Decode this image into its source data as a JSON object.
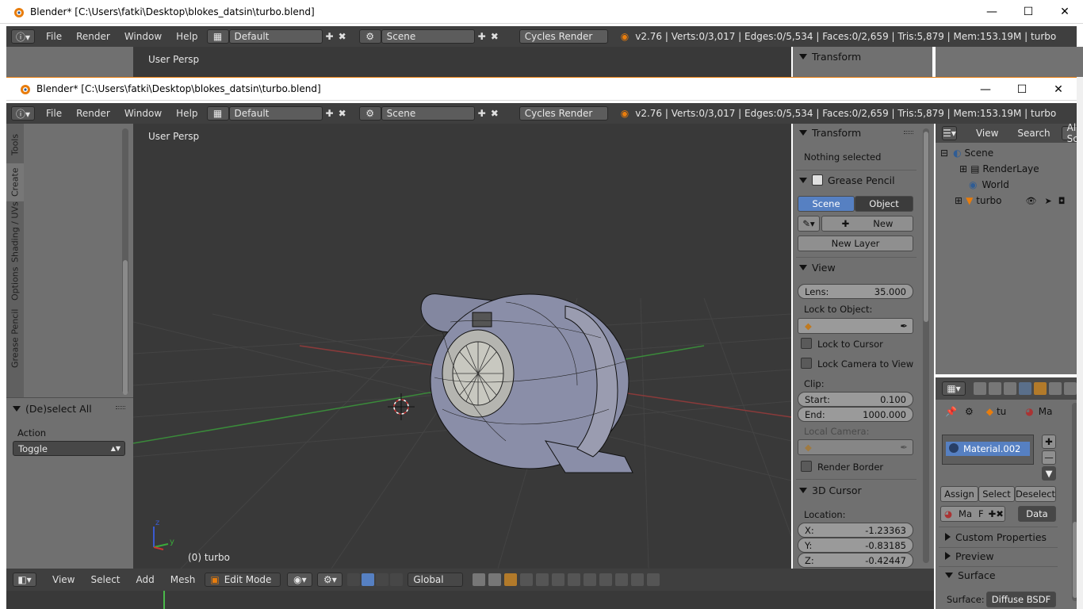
{
  "window": {
    "title": "Blender* [C:\\Users\\fatki\\Desktop\\blokes_datsin\\turbo.blend]",
    "minimize": "—",
    "maximize": "☐",
    "close": "✕"
  },
  "menu": [
    "File",
    "Render",
    "Window",
    "Help"
  ],
  "layout": {
    "name": "Default"
  },
  "scene": {
    "name": "Scene"
  },
  "render_engine": "Cycles Render",
  "stats": "v2.76 | Verts:0/3,017 | Edges:0/5,534 | Faces:0/2,659 | Tris:5,879 | Mem:153.19M | turbo",
  "toolshelf": {
    "tabs": [
      "Tools",
      "Create",
      "Shading / UVs",
      "Options",
      "Grease Pencil"
    ],
    "operator": {
      "title": "(De)select All",
      "action_label": "Action",
      "action_value": "Toggle"
    }
  },
  "viewport": {
    "view_name": "User Persp",
    "object_label": "(0) turbo",
    "axis_z": "z",
    "axis_y": "y"
  },
  "properties_panel": {
    "transform": {
      "title": "Transform",
      "status": "Nothing selected"
    },
    "grease_pencil": {
      "title": "Grease Pencil",
      "scene_btn": "Scene",
      "object_btn": "Object",
      "new_btn": "New",
      "new_layer_btn": "New Layer"
    },
    "view": {
      "title": "View",
      "lens_label": "Lens:",
      "lens_value": "35.000",
      "lock_to_object": "Lock to Object:",
      "lock_to_cursor": "Lock to Cursor",
      "lock_camera": "Lock Camera to View",
      "clip_label": "Clip:",
      "clip_start_label": "Start:",
      "clip_start": "0.100",
      "clip_end_label": "End:",
      "clip_end": "1000.000",
      "local_camera": "Local Camera:",
      "render_border": "Render Border"
    },
    "cursor": {
      "title": "3D Cursor",
      "location": "Location:",
      "x_label": "X:",
      "x": "-1.23363",
      "y_label": "Y:",
      "y": "-0.83185",
      "z_label": "Z:",
      "z": "-0.42447"
    }
  },
  "outliner": {
    "menu": [
      "View",
      "Search"
    ],
    "filter": "All Sc",
    "items": [
      {
        "label": "Scene"
      },
      {
        "label": "RenderLaye"
      },
      {
        "label": "World"
      },
      {
        "label": "turbo"
      }
    ]
  },
  "material_panel": {
    "context_object": "tu",
    "context_mat": "Ma",
    "material_slot": "Material.002",
    "assign": "Assign",
    "select": "Select",
    "deselect": "Deselect",
    "mat_short": "Ma",
    "f_label": "F",
    "data_label": "Data",
    "custom_props": "Custom Properties",
    "preview": "Preview",
    "surface": "Surface",
    "surface_label": "Surface:",
    "surface_value": "Diffuse BSDF"
  },
  "bottom_bar": {
    "menus": [
      "View",
      "Select",
      "Add",
      "Mesh"
    ],
    "mode": "Edit Mode",
    "orientation": "Global"
  },
  "colors": {
    "accent": "#5680c2",
    "panel": "#707070",
    "viewport": "#393939",
    "header": "#3f3f3f"
  }
}
